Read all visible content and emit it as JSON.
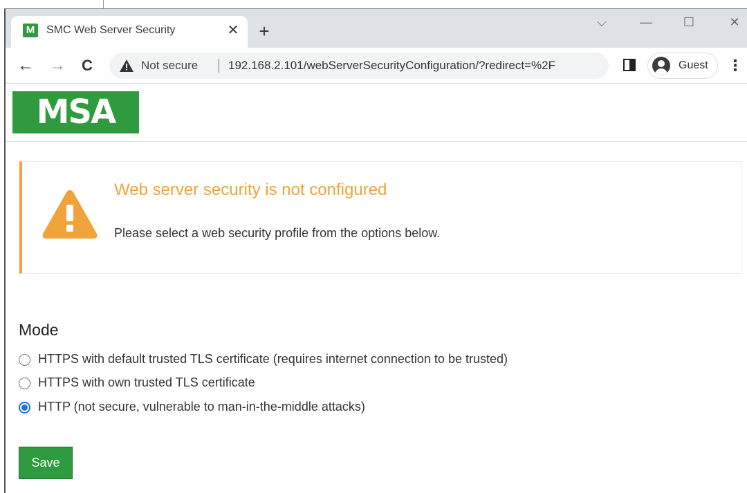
{
  "browser": {
    "tab_title": "SMC Web Server Security",
    "tab_favicon_text": "M",
    "new_tab_label": "+",
    "close_tab_label": "✕",
    "window_controls": {
      "dropdown": "⌵",
      "minimize": "—",
      "maximize": "☐",
      "close": "✕"
    },
    "nav": {
      "back": "←",
      "forward": "→",
      "reload": "C"
    },
    "security_label": "Not secure",
    "url": "192.168.2.101/webServerSecurityConfiguration/?redirect=%2F",
    "profile_label": "Guest",
    "menu_label": "⋮",
    "icons": [
      "favicon-icon",
      "close-icon",
      "plus-icon",
      "back-arrow-icon",
      "forward-arrow-icon",
      "reload-icon",
      "warning-icon",
      "side-panel-icon",
      "profile-icon",
      "kebab-menu-icon"
    ]
  },
  "page": {
    "logo_text": "MSA",
    "brand_color": "#2e9b3e",
    "alert": {
      "title": "Web server security is not configured",
      "message": "Please select a web security profile from the options below.",
      "color": "#f0a33a"
    },
    "mode": {
      "heading": "Mode",
      "options": [
        {
          "label": "HTTPS with default trusted TLS certificate (requires internet connection to be trusted)",
          "checked": false
        },
        {
          "label": "HTTPS with own trusted TLS certificate",
          "checked": false
        },
        {
          "label": "HTTP (not secure, vulnerable to man-in-the-middle attacks)",
          "checked": true
        }
      ]
    },
    "save_label": "Save"
  }
}
